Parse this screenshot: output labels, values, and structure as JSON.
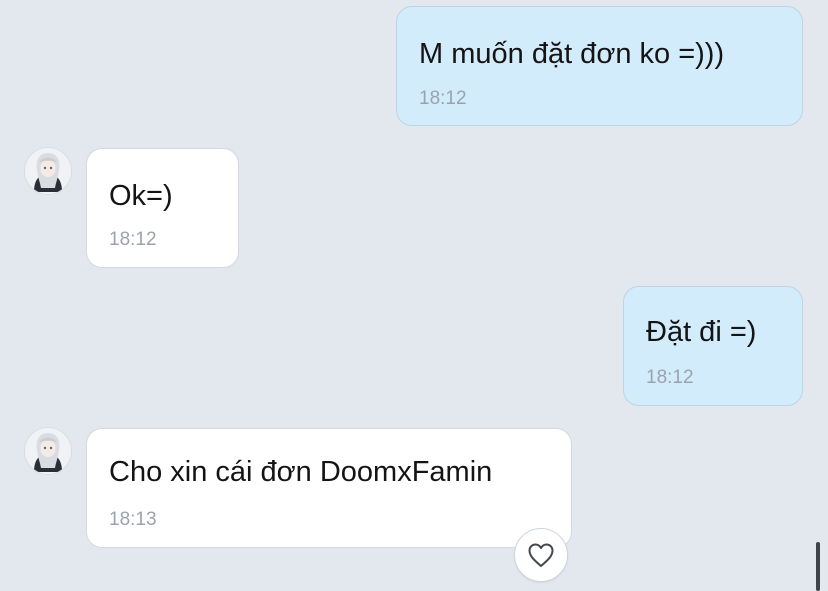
{
  "conversation": {
    "messages": [
      {
        "direction": "outgoing",
        "text": "M muốn đặt đơn ko =)))",
        "time": "18:12"
      },
      {
        "direction": "incoming",
        "text": "Ok=)",
        "time": "18:12"
      },
      {
        "direction": "outgoing",
        "text": "Đặt đi =)",
        "time": "18:12"
      },
      {
        "direction": "incoming",
        "text": "Cho xin cái đơn DoomxFamin",
        "time": "18:13"
      }
    ]
  },
  "icons": {
    "avatar": "avatar-icon",
    "react": "heart-outline-icon"
  },
  "colors": {
    "background": "#e3e7ee",
    "outgoing_bubble": "#d3ecfc",
    "incoming_bubble": "#ffffff",
    "timestamp": "#9aa3ad"
  }
}
